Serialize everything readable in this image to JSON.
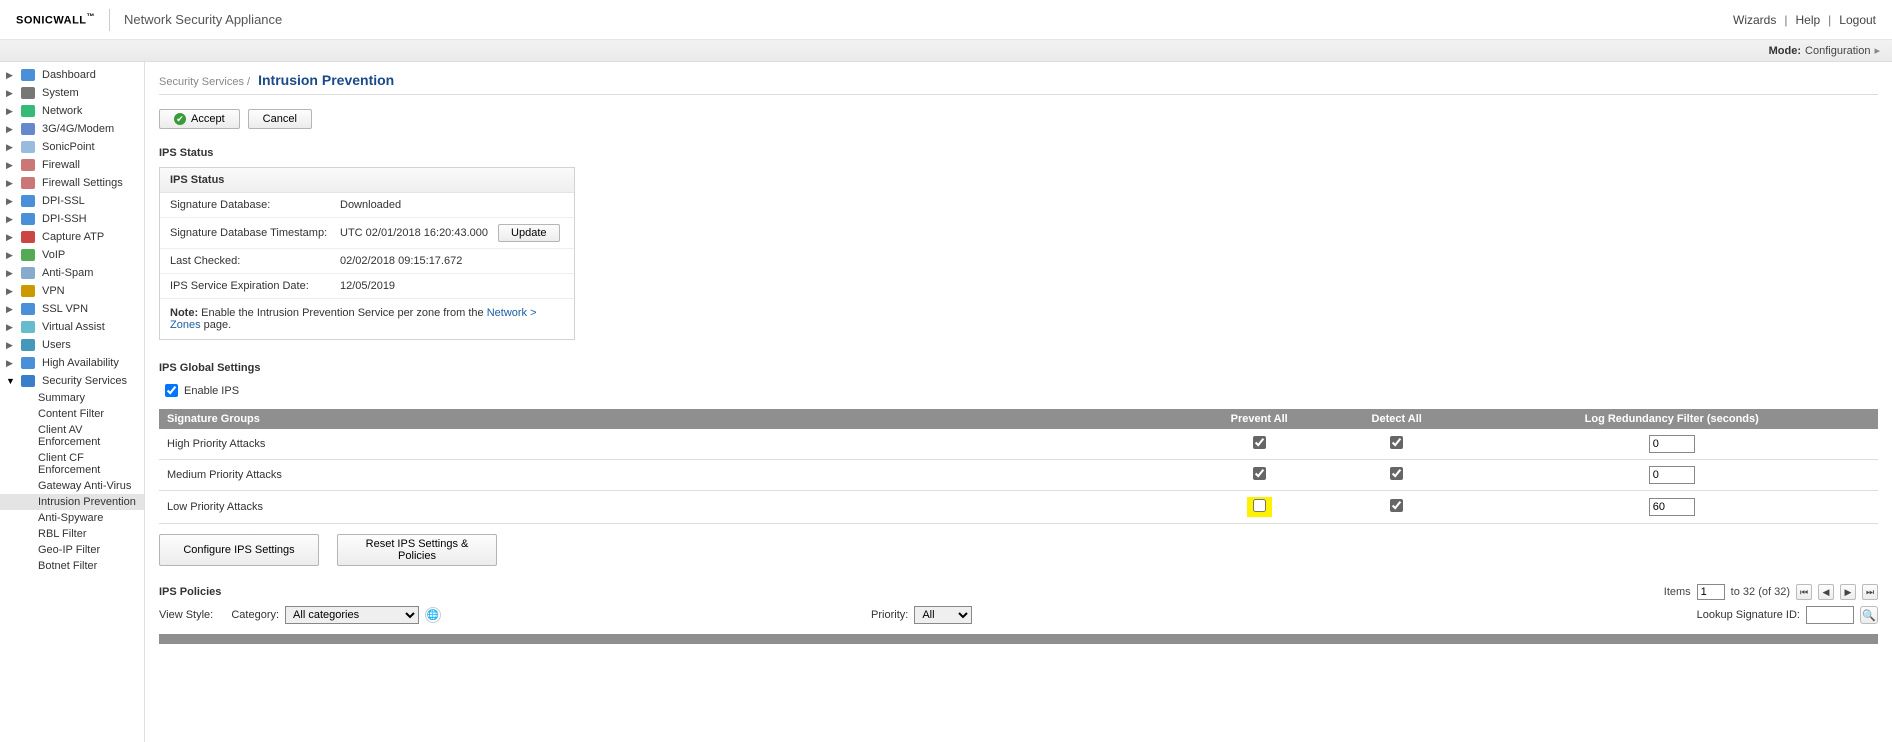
{
  "header": {
    "brand_a": "SONIC",
    "brand_b": "WALL",
    "appliance": "Network Security Appliance",
    "links": {
      "wizards": "Wizards",
      "help": "Help",
      "logout": "Logout"
    }
  },
  "modebar": {
    "label": "Mode:",
    "value": "Configuration",
    "arrow": "▸"
  },
  "sidebar": {
    "items": [
      {
        "label": "Dashboard",
        "icon": "#4a90d9"
      },
      {
        "label": "System",
        "icon": "#777"
      },
      {
        "label": "Network",
        "icon": "#3b7"
      },
      {
        "label": "3G/4G/Modem",
        "icon": "#68c"
      },
      {
        "label": "SonicPoint",
        "icon": "#9bd"
      },
      {
        "label": "Firewall",
        "icon": "#c77"
      },
      {
        "label": "Firewall Settings",
        "icon": "#c77"
      },
      {
        "label": "DPI-SSL",
        "icon": "#4a90d9"
      },
      {
        "label": "DPI-SSH",
        "icon": "#4a90d9"
      },
      {
        "label": "Capture ATP",
        "icon": "#c44"
      },
      {
        "label": "VoIP",
        "icon": "#5a5"
      },
      {
        "label": "Anti-Spam",
        "icon": "#8ac"
      },
      {
        "label": "VPN",
        "icon": "#c90"
      },
      {
        "label": "SSL VPN",
        "icon": "#4a90d9"
      },
      {
        "label": "Virtual Assist",
        "icon": "#6bc"
      },
      {
        "label": "Users",
        "icon": "#49b"
      },
      {
        "label": "High Availability",
        "icon": "#4a90d9"
      },
      {
        "label": "Security Services",
        "icon": "#3a7ecb"
      }
    ],
    "subitems": [
      {
        "label": "Summary"
      },
      {
        "label": "Content Filter"
      },
      {
        "label": "Client AV Enforcement"
      },
      {
        "label": "Client CF Enforcement"
      },
      {
        "label": "Gateway Anti-Virus"
      },
      {
        "label": "Intrusion Prevention"
      },
      {
        "label": "Anti-Spyware"
      },
      {
        "label": "RBL Filter"
      },
      {
        "label": "Geo-IP Filter"
      },
      {
        "label": "Botnet Filter"
      }
    ],
    "selected_sub": "Intrusion Prevention"
  },
  "breadcrumb": {
    "parent": "Security Services /",
    "title": "Intrusion Prevention"
  },
  "actions": {
    "accept": "Accept",
    "cancel": "Cancel"
  },
  "ips_status": {
    "section_label": "IPS Status",
    "box_title": "IPS Status",
    "rows": [
      {
        "label": "Signature Database:",
        "value": "Downloaded"
      },
      {
        "label": "Signature Database Timestamp:",
        "value": "UTC 02/01/2018 16:20:43.000"
      },
      {
        "label": "Last Checked:",
        "value": "02/02/2018 09:15:17.672"
      },
      {
        "label": "IPS Service Expiration Date:",
        "value": "12/05/2019"
      }
    ],
    "update_btn": "Update",
    "note_label": "Note:",
    "note_text_a": " Enable the Intrusion Prevention Service per zone from the ",
    "note_link": "Network > Zones",
    "note_text_b": " page."
  },
  "ips_global": {
    "section_label": "IPS Global Settings",
    "enable_label": "Enable IPS",
    "cols": {
      "sig": "Signature Groups",
      "prevent": "Prevent All",
      "detect": "Detect All",
      "log": "Log Redundancy Filter (seconds)"
    },
    "rows": [
      {
        "name": "High Priority Attacks",
        "prevent": true,
        "detect": true,
        "log": "0"
      },
      {
        "name": "Medium Priority Attacks",
        "prevent": true,
        "detect": true,
        "log": "0"
      },
      {
        "name": "Low Priority Attacks",
        "prevent": false,
        "detect": true,
        "log": "60",
        "highlight": true
      }
    ],
    "btn_configure": "Configure IPS Settings",
    "btn_reset": "Reset IPS Settings & Policies"
  },
  "ips_policies": {
    "section_label": "IPS Policies",
    "items_label": "Items",
    "page_value": "1",
    "range": "to 32 (of 32)",
    "view_style": "View Style:",
    "category_label": "Category:",
    "category_value": "All categories",
    "priority_label": "Priority:",
    "priority_value": "All",
    "lookup_label": "Lookup Signature ID:"
  }
}
